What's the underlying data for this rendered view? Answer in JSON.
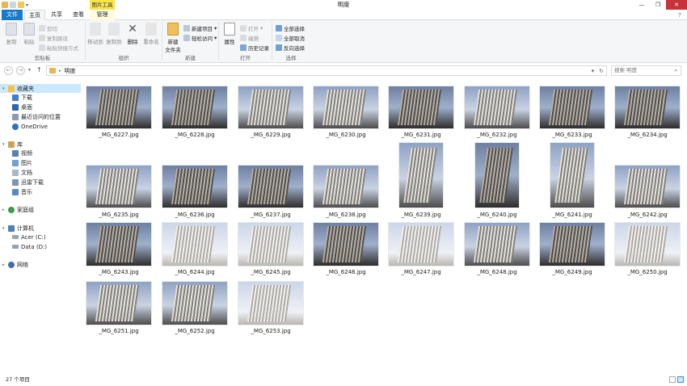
{
  "window": {
    "title": "明度",
    "minimize": "—",
    "maximize": "❐",
    "close": "✕"
  },
  "tabs": {
    "file": "文件",
    "home": "主页",
    "share": "共享",
    "view": "查看",
    "manage": "管理",
    "context_header": "图片工具"
  },
  "ribbon": {
    "clipboard": {
      "label": "剪贴板",
      "copy": "复制",
      "paste": "粘贴",
      "cut": "剪切",
      "copy_path": "复制路径",
      "paste_shortcut": "粘贴快捷方式"
    },
    "organize": {
      "label": "组织",
      "move_to": "移动到",
      "copy_to": "复制到",
      "delete": "删除",
      "rename": "重命名"
    },
    "new": {
      "label": "新建",
      "new_folder_line1": "新建",
      "new_folder_line2": "文件夹",
      "new_item": "新建项目",
      "easy_access": "轻松访问"
    },
    "open": {
      "label": "打开",
      "properties": "属性",
      "open": "打开",
      "edit": "编辑",
      "history": "历史记录"
    },
    "select": {
      "label": "选择",
      "select_all": "全部选择",
      "select_none": "全部取消",
      "invert": "反向选择"
    }
  },
  "address": {
    "path": "明度",
    "search_placeholder": "搜索 明度"
  },
  "nav": {
    "favorites": "收藏夹",
    "downloads": "下载",
    "desktop": "桌面",
    "recent": "最近访问的位置",
    "onedrive": "OneDrive",
    "libraries": "库",
    "videos": "视频",
    "pictures": "图片",
    "documents": "文档",
    "thunder": "迅雷下载",
    "music": "音乐",
    "homegroup": "家庭组",
    "computer": "计算机",
    "drive_c": "Acer (C:)",
    "drive_d": "Data (D:)",
    "network": "网络"
  },
  "files": [
    "_MG_6227.jpg",
    "_MG_6228.jpg",
    "_MG_6229.jpg",
    "_MG_6230.jpg",
    "_MG_6231.jpg",
    "_MG_6232.jpg",
    "_MG_6233.jpg",
    "_MG_6234.jpg",
    "_MG_6235.jpg",
    "_MG_6236.jpg",
    "_MG_6237.jpg",
    "_MG_6238.jpg",
    "_MG_6239.jpg",
    "_MG_6240.jpg",
    "_MG_6241.jpg",
    "_MG_6242.jpg",
    "_MG_6243.jpg",
    "_MG_6244.jpg",
    "_MG_6245.jpg",
    "_MG_6246.jpg",
    "_MG_6247.jpg",
    "_MG_6248.jpg",
    "_MG_6249.jpg",
    "_MG_6250.jpg",
    "_MG_6251.jpg",
    "_MG_6252.jpg",
    "_MG_6253.jpg"
  ],
  "status": {
    "count": "27 个项目"
  }
}
